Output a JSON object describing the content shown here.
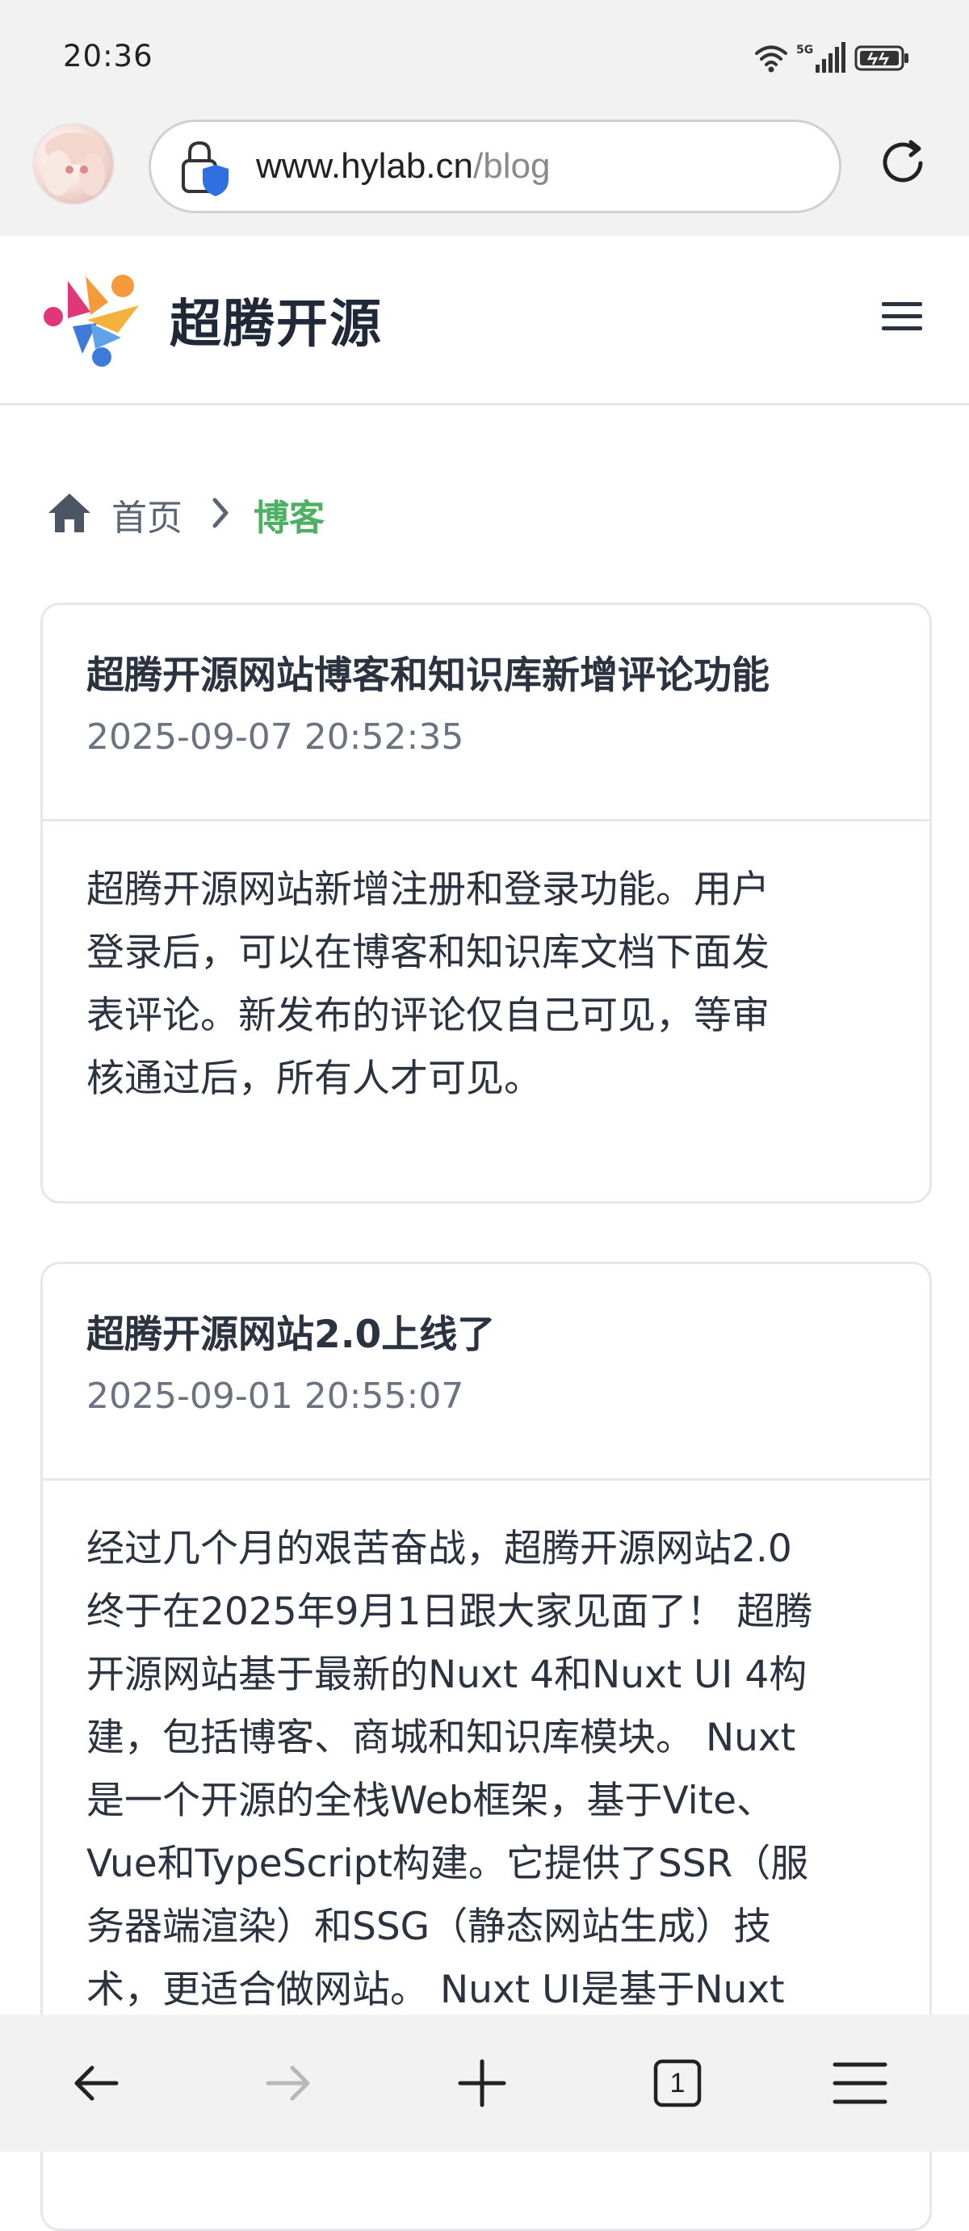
{
  "status_bar": {
    "time": "20:36",
    "network": "5G",
    "icons": [
      "wifi-icon",
      "signal-icon",
      "battery-icon"
    ]
  },
  "browser": {
    "url_host": "www.hylab.cn",
    "url_path": "/blog",
    "icons": [
      "avatar",
      "lock-icon",
      "reload-icon"
    ]
  },
  "site": {
    "name": "超腾开源",
    "icons": [
      "logo",
      "menu-icon"
    ]
  },
  "breadcrumb": {
    "home": "首页",
    "current": "博客"
  },
  "posts": [
    {
      "title": "超腾开源网站博客和知识库新增评论功能",
      "date": "2025-09-07 20:52:35",
      "excerpt_lines": [
        "超腾开源网站新增注册和登录功能。用户",
        "登录后，可以在博客和知识库文档下面发",
        "表评论。新发布的评论仅自己可见，等审",
        "核通过后，所有人才可见。"
      ]
    },
    {
      "title": "超腾开源网站2.0上线了",
      "date": "2025-09-01 20:55:07",
      "excerpt_lines": [
        "经过几个月的艰苦奋战，超腾开源网站2.0",
        "终于在2025年9月1日跟大家见面了！ 超腾",
        "开源网站基于最新的Nuxt 4和Nuxt UI 4构",
        "建，包括博客、商城和知识库模块。 Nuxt",
        "是一个开源的全栈Web框架，基于Vite、",
        "Vue和TypeScript构建。它提供了SSR（服",
        "务器端渲染）和SSG（静态网站生成）技",
        "术，更适合做网站。 Nuxt UI是基于Nuxt"
      ]
    }
  ],
  "bottom_nav": {
    "tab_count": "1",
    "icons": [
      "back-icon",
      "forward-icon",
      "add-tab-icon",
      "tabs-icon",
      "menu-icon"
    ]
  },
  "colors": {
    "accent_green": "#4caf62",
    "text_dark": "#2b3340",
    "text_muted": "#6b7280",
    "border": "#e5e7eb",
    "chrome_bg": "#f2f2f2",
    "lock_badge": "#2f6fe0"
  }
}
